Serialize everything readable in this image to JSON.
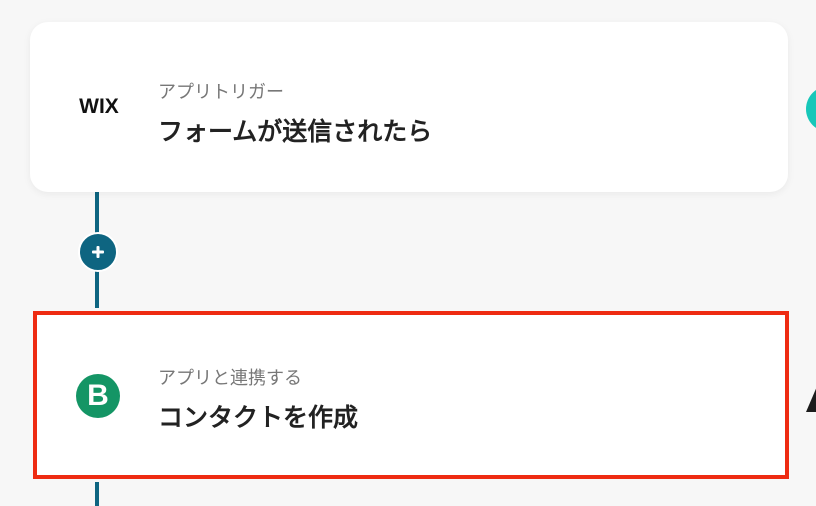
{
  "trigger": {
    "app_logo": "WIX",
    "subtitle": "アプリトリガー",
    "title": "フォームが送信されたら"
  },
  "action": {
    "app_logo": "B",
    "subtitle": "アプリと連携する",
    "title": "コンタクトを作成"
  },
  "add_step_icon": "plus-icon",
  "colors": {
    "connector": "#0e6581",
    "highlight": "#ee2b12",
    "bigin_green": "#149565",
    "teal": "#17c7b9"
  }
}
